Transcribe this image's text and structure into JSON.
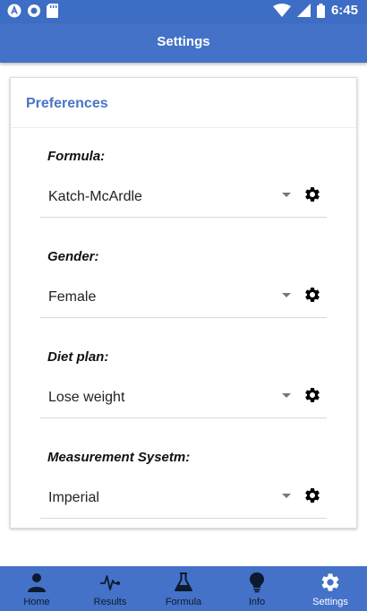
{
  "status_bar": {
    "time": "6:45"
  },
  "app_bar": {
    "title": "Settings"
  },
  "card": {
    "title": "Preferences"
  },
  "preferences": [
    {
      "label": "Formula:",
      "value": "Katch-McArdle"
    },
    {
      "label": "Gender:",
      "value": "Female"
    },
    {
      "label": "Diet plan:",
      "value": "Lose weight"
    },
    {
      "label": "Measurement Sysetm:",
      "value": "Imperial"
    }
  ],
  "bottom_nav": {
    "active": "Settings",
    "items": [
      {
        "label": "Home",
        "icon": "person-icon"
      },
      {
        "label": "Results",
        "icon": "pulse-icon"
      },
      {
        "label": "Formula",
        "icon": "flask-icon"
      },
      {
        "label": "Info",
        "icon": "lightbulb-icon"
      },
      {
        "label": "Settings",
        "icon": "gear-icon"
      }
    ]
  },
  "colors": {
    "primary": "#4472c8",
    "status_bar": "#3d6dc4",
    "section_title": "#4a74c6",
    "nav_active": "#ffffff",
    "nav_inactive": "#0d1a2e"
  }
}
